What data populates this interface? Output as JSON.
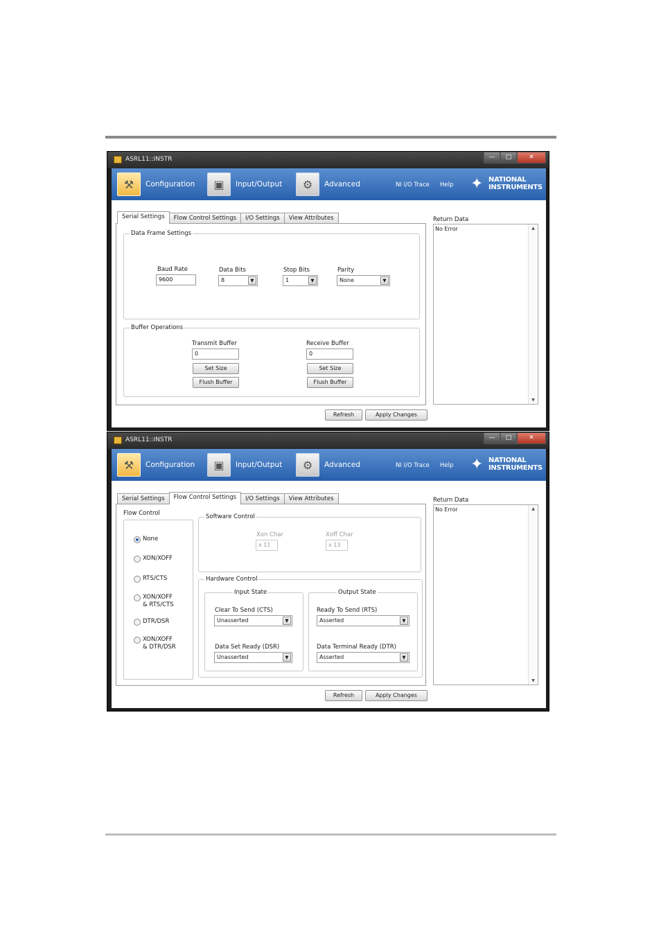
{
  "windows": [
    {
      "title": "ASRL11::INSTR",
      "controls": {
        "minimize": "—",
        "maximize": "□",
        "close": "✕"
      },
      "nav": {
        "configuration": "Configuration",
        "io": "Input/Output",
        "advanced": "Advanced",
        "trace": "NI I/O Trace",
        "help": "Help"
      },
      "logo": {
        "line1": "NATIONAL",
        "line2": "INSTRUMENTS"
      },
      "tabs": [
        "Serial Settings",
        "Flow Control Settings",
        "I/O Settings",
        "View Attributes"
      ],
      "selected_tab": "Serial Settings",
      "data_frame": {
        "title": "Data Frame Settings",
        "baud_label": "Baud Rate",
        "baud_value": "9600",
        "databits_label": "Data Bits",
        "databits_value": "8",
        "stopbits_label": "Stop Bits",
        "stopbits_value": "1",
        "parity_label": "Parity",
        "parity_value": "None"
      },
      "buffer_ops": {
        "title": "Buffer Operations",
        "transmit_label": "Transmit Buffer",
        "transmit_value": "0",
        "receive_label": "Receive Buffer",
        "receive_value": "0",
        "set_size": "Set Size",
        "flush": "Flush Buffer"
      },
      "refresh": "Refresh",
      "apply": "Apply Changes",
      "return_label": "Return Data",
      "return_value": "No Error"
    },
    {
      "title": "ASRL11::INSTR",
      "controls": {
        "minimize": "—",
        "maximize": "□",
        "close": "✕"
      },
      "nav": {
        "configuration": "Configuration",
        "io": "Input/Output",
        "advanced": "Advanced",
        "trace": "NI I/O Trace",
        "help": "Help"
      },
      "logo": {
        "line1": "NATIONAL",
        "line2": "INSTRUMENTS"
      },
      "tabs": [
        "Serial Settings",
        "Flow Control Settings",
        "I/O Settings",
        "View Attributes"
      ],
      "selected_tab": "Flow Control Settings",
      "flow_control": {
        "title": "Flow Control",
        "options": [
          "None",
          "XON/XOFF",
          "RTS/CTS",
          "XON/XOFF\n& RTS/CTS",
          "DTR/DSR",
          "XON/XOFF\n& DTR/DSR"
        ],
        "selected": "None"
      },
      "software_control": {
        "title": "Software Control",
        "xon_label": "Xon Char",
        "xon_value": "x 11",
        "xoff_label": "Xoff Char",
        "xoff_value": "x 13"
      },
      "hardware_control": {
        "title": "Hardware Control",
        "input_state": "Input State",
        "output_state": "Output State",
        "cts_label": "Clear To Send (CTS)",
        "cts_value": "Unasserted",
        "dsr_label": "Data Set Ready (DSR)",
        "dsr_value": "Unasserted",
        "rts_label": "Ready To Send (RTS)",
        "rts_value": "Asserted",
        "dtr_label": "Data Terminal Ready (DTR)",
        "dtr_value": "Asserted"
      },
      "refresh": "Refresh",
      "apply": "Apply Changes",
      "return_label": "Return Data",
      "return_value": "No Error"
    }
  ]
}
